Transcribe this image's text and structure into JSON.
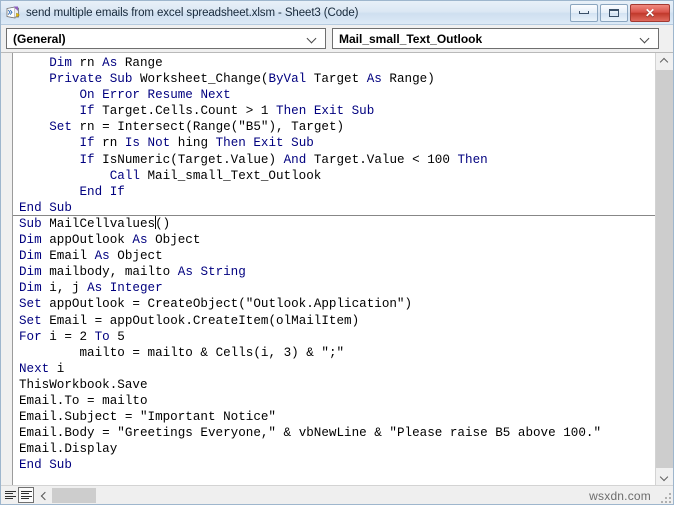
{
  "window": {
    "title": "send multiple emails from excel spreadsheet.xlsm - Sheet3 (Code)",
    "icon": "excel-worksheet-icon",
    "controls": {
      "minimize_label": "–",
      "maximize_label": "□",
      "close_label": "✕"
    }
  },
  "toolbar": {
    "object_combo": {
      "value": "(General)",
      "arrow": "chevron-down-icon"
    },
    "procedure_combo": {
      "value": "Mail_small_Text_Outlook",
      "arrow": "chevron-down-icon"
    }
  },
  "code": {
    "lines": [
      {
        "text": "Dim rn As Range",
        "indent": 1,
        "keywords": [
          "Dim",
          "As"
        ]
      },
      {
        "text": "Private Sub Worksheet_Change(ByVal Target As Range)",
        "indent": 1,
        "keywords": [
          "Private",
          "Sub",
          "ByVal",
          "As"
        ]
      },
      {
        "text": "On Error Resume Next",
        "indent": 2,
        "keywords": [
          "On",
          "Error",
          "Resume",
          "Next"
        ]
      },
      {
        "text": "If Target.Cells.Count > 1 Then Exit Sub",
        "indent": 2,
        "keywords": [
          "If",
          "Then",
          "Exit",
          "Sub"
        ]
      },
      {
        "text": "Set rn = Intersect(Range(\"B5\"), Target)",
        "indent": 1,
        "keywords": [
          "Set"
        ]
      },
      {
        "text": "If rn Is Not hing Then Exit Sub",
        "indent": 2,
        "keywords": [
          "If",
          "Is",
          "Not",
          "Then",
          "Exit",
          "Sub"
        ]
      },
      {
        "text": "If IsNumeric(Target.Value) And Target.Value < 100 Then",
        "indent": 2,
        "keywords": [
          "If",
          "And",
          "Then"
        ]
      },
      {
        "text": "Call Mail_small_Text_Outlook",
        "indent": 3,
        "keywords": [
          "Call"
        ]
      },
      {
        "text": "End If",
        "indent": 2,
        "keywords": [
          "End",
          "If"
        ]
      },
      {
        "text": "End Sub",
        "indent": 0,
        "keywords": [
          "End",
          "Sub"
        ]
      },
      {
        "text": "Sub MailCellvalues()",
        "indent": 0,
        "keywords": [
          "Sub"
        ],
        "separator": true,
        "caret_after": "Sub MailCellvalues"
      },
      {
        "text": "Dim appOutlook As Object",
        "indent": 0,
        "keywords": [
          "Dim",
          "As"
        ]
      },
      {
        "text": "Dim Email As Object",
        "indent": 0,
        "keywords": [
          "Dim",
          "As"
        ]
      },
      {
        "text": "Dim mailbody, mailto As String",
        "indent": 0,
        "keywords": [
          "Dim",
          "As",
          "String"
        ]
      },
      {
        "text": "Dim i, j As Integer",
        "indent": 0,
        "keywords": [
          "Dim",
          "As",
          "Integer"
        ]
      },
      {
        "text": "Set appOutlook = CreateObject(\"Outlook.Application\")",
        "indent": 0,
        "keywords": [
          "Set"
        ]
      },
      {
        "text": "Set Email = appOutlook.CreateItem(olMailItem)",
        "indent": 0,
        "keywords": [
          "Set"
        ]
      },
      {
        "text": "For i = 2 To 5",
        "indent": 0,
        "keywords": [
          "For",
          "To"
        ]
      },
      {
        "text": "mailto = mailto & Cells(i, 3) & \";\"",
        "indent": 2,
        "keywords": []
      },
      {
        "text": "Next i",
        "indent": 0,
        "keywords": [
          "Next"
        ]
      },
      {
        "text": "ThisWorkbook.Save",
        "indent": 0,
        "keywords": []
      },
      {
        "text": "Email.To = mailto",
        "indent": 0,
        "keywords": []
      },
      {
        "text": "Email.Subject = \"Important Notice\"",
        "indent": 0,
        "keywords": []
      },
      {
        "text": "Email.Body = \"Greetings Everyone,\" & vbNewLine & \"Please raise B5 above 100.\"",
        "indent": 0,
        "keywords": []
      },
      {
        "text": "Email.Display",
        "indent": 0,
        "keywords": []
      },
      {
        "text": "End Sub",
        "indent": 0,
        "keywords": [
          "End",
          "Sub"
        ]
      }
    ],
    "keyword_color": "#00007F",
    "text_color": "#000000",
    "background": "#FFFFFF"
  },
  "scrollbars": {
    "vertical": {
      "up_icon": "chevron-up-icon",
      "down_icon": "chevron-down-icon"
    },
    "horizontal": {
      "left_icon": "chevron-left-icon"
    }
  },
  "view_buttons": {
    "procedure_view": "procedure-view-icon",
    "full_module_view": "full-module-view-icon"
  },
  "watermark": "wsxdn.com"
}
